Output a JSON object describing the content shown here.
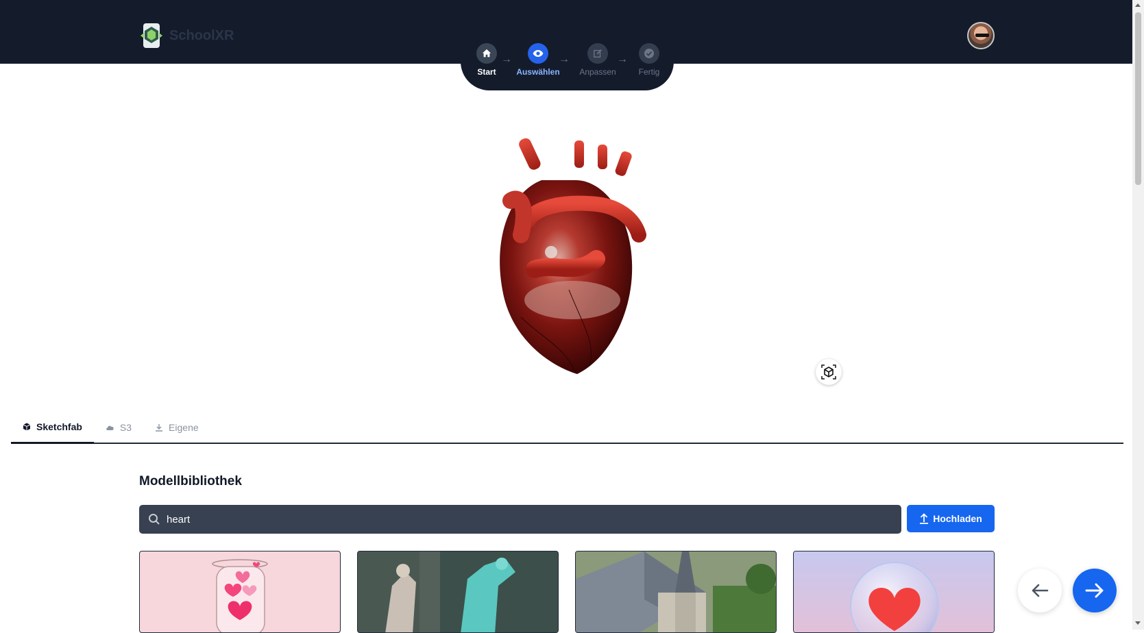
{
  "app": {
    "name": "SchoolXR"
  },
  "stepper": {
    "steps": [
      {
        "label": "Start",
        "icon": "home-icon",
        "state": "done"
      },
      {
        "label": "Auswählen",
        "icon": "eye-icon",
        "state": "active"
      },
      {
        "label": "Anpassen",
        "icon": "edit-icon",
        "state": "upcoming"
      },
      {
        "label": "Fertig",
        "icon": "check-circle-icon",
        "state": "upcoming"
      }
    ]
  },
  "viewer": {
    "model_icon": "3d-heart-model",
    "ar_button_icon": "ar-cube-icon"
  },
  "tabs": [
    {
      "label": "Sketchfab",
      "icon": "cube-icon",
      "active": true
    },
    {
      "label": "S3",
      "icon": "cloud-icon",
      "active": false
    },
    {
      "label": "Eigene",
      "icon": "download-icon",
      "active": false
    }
  ],
  "library": {
    "title": "Modellbibliothek",
    "search_value": "heart",
    "upload_label": "Hochladen"
  },
  "results": [
    {
      "thumb": "jar-of-hearts"
    },
    {
      "thumb": "statue-scene"
    },
    {
      "thumb": "church-building"
    },
    {
      "thumb": "heart-in-bubble"
    }
  ],
  "colors": {
    "header_bg": "#141c2c",
    "accent": "#1666f0",
    "search_bg": "#374151"
  }
}
